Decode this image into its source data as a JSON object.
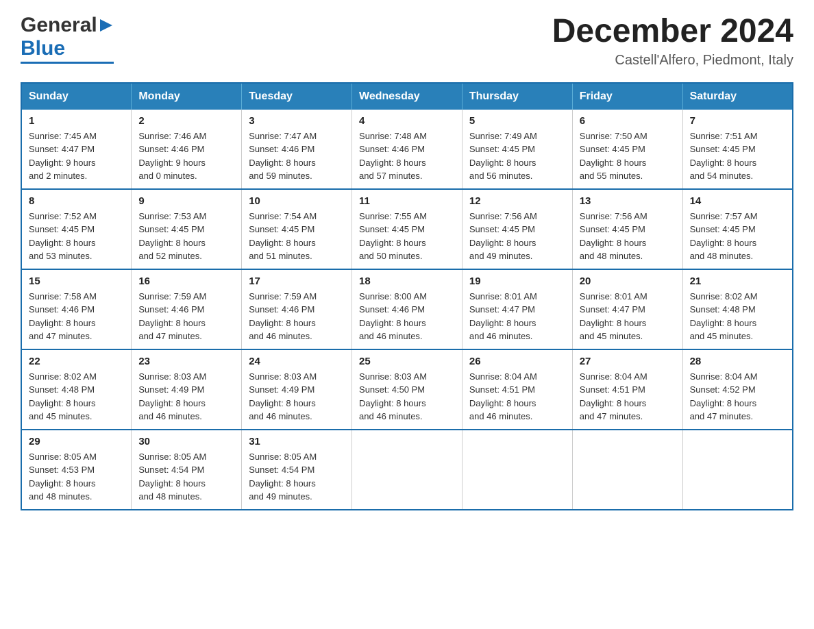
{
  "header": {
    "logo_general": "General",
    "logo_blue": "Blue",
    "month_title": "December 2024",
    "subtitle": "Castell'Alfero, Piedmont, Italy"
  },
  "days_of_week": [
    "Sunday",
    "Monday",
    "Tuesday",
    "Wednesday",
    "Thursday",
    "Friday",
    "Saturday"
  ],
  "weeks": [
    [
      {
        "num": "1",
        "sunrise": "7:45 AM",
        "sunset": "4:47 PM",
        "daylight": "9 hours and 2 minutes."
      },
      {
        "num": "2",
        "sunrise": "7:46 AM",
        "sunset": "4:46 PM",
        "daylight": "9 hours and 0 minutes."
      },
      {
        "num": "3",
        "sunrise": "7:47 AM",
        "sunset": "4:46 PM",
        "daylight": "8 hours and 59 minutes."
      },
      {
        "num": "4",
        "sunrise": "7:48 AM",
        "sunset": "4:46 PM",
        "daylight": "8 hours and 57 minutes."
      },
      {
        "num": "5",
        "sunrise": "7:49 AM",
        "sunset": "4:45 PM",
        "daylight": "8 hours and 56 minutes."
      },
      {
        "num": "6",
        "sunrise": "7:50 AM",
        "sunset": "4:45 PM",
        "daylight": "8 hours and 55 minutes."
      },
      {
        "num": "7",
        "sunrise": "7:51 AM",
        "sunset": "4:45 PM",
        "daylight": "8 hours and 54 minutes."
      }
    ],
    [
      {
        "num": "8",
        "sunrise": "7:52 AM",
        "sunset": "4:45 PM",
        "daylight": "8 hours and 53 minutes."
      },
      {
        "num": "9",
        "sunrise": "7:53 AM",
        "sunset": "4:45 PM",
        "daylight": "8 hours and 52 minutes."
      },
      {
        "num": "10",
        "sunrise": "7:54 AM",
        "sunset": "4:45 PM",
        "daylight": "8 hours and 51 minutes."
      },
      {
        "num": "11",
        "sunrise": "7:55 AM",
        "sunset": "4:45 PM",
        "daylight": "8 hours and 50 minutes."
      },
      {
        "num": "12",
        "sunrise": "7:56 AM",
        "sunset": "4:45 PM",
        "daylight": "8 hours and 49 minutes."
      },
      {
        "num": "13",
        "sunrise": "7:56 AM",
        "sunset": "4:45 PM",
        "daylight": "8 hours and 48 minutes."
      },
      {
        "num": "14",
        "sunrise": "7:57 AM",
        "sunset": "4:45 PM",
        "daylight": "8 hours and 48 minutes."
      }
    ],
    [
      {
        "num": "15",
        "sunrise": "7:58 AM",
        "sunset": "4:46 PM",
        "daylight": "8 hours and 47 minutes."
      },
      {
        "num": "16",
        "sunrise": "7:59 AM",
        "sunset": "4:46 PM",
        "daylight": "8 hours and 47 minutes."
      },
      {
        "num": "17",
        "sunrise": "7:59 AM",
        "sunset": "4:46 PM",
        "daylight": "8 hours and 46 minutes."
      },
      {
        "num": "18",
        "sunrise": "8:00 AM",
        "sunset": "4:46 PM",
        "daylight": "8 hours and 46 minutes."
      },
      {
        "num": "19",
        "sunrise": "8:01 AM",
        "sunset": "4:47 PM",
        "daylight": "8 hours and 46 minutes."
      },
      {
        "num": "20",
        "sunrise": "8:01 AM",
        "sunset": "4:47 PM",
        "daylight": "8 hours and 45 minutes."
      },
      {
        "num": "21",
        "sunrise": "8:02 AM",
        "sunset": "4:48 PM",
        "daylight": "8 hours and 45 minutes."
      }
    ],
    [
      {
        "num": "22",
        "sunrise": "8:02 AM",
        "sunset": "4:48 PM",
        "daylight": "8 hours and 45 minutes."
      },
      {
        "num": "23",
        "sunrise": "8:03 AM",
        "sunset": "4:49 PM",
        "daylight": "8 hours and 46 minutes."
      },
      {
        "num": "24",
        "sunrise": "8:03 AM",
        "sunset": "4:49 PM",
        "daylight": "8 hours and 46 minutes."
      },
      {
        "num": "25",
        "sunrise": "8:03 AM",
        "sunset": "4:50 PM",
        "daylight": "8 hours and 46 minutes."
      },
      {
        "num": "26",
        "sunrise": "8:04 AM",
        "sunset": "4:51 PM",
        "daylight": "8 hours and 46 minutes."
      },
      {
        "num": "27",
        "sunrise": "8:04 AM",
        "sunset": "4:51 PM",
        "daylight": "8 hours and 47 minutes."
      },
      {
        "num": "28",
        "sunrise": "8:04 AM",
        "sunset": "4:52 PM",
        "daylight": "8 hours and 47 minutes."
      }
    ],
    [
      {
        "num": "29",
        "sunrise": "8:05 AM",
        "sunset": "4:53 PM",
        "daylight": "8 hours and 48 minutes."
      },
      {
        "num": "30",
        "sunrise": "8:05 AM",
        "sunset": "4:54 PM",
        "daylight": "8 hours and 48 minutes."
      },
      {
        "num": "31",
        "sunrise": "8:05 AM",
        "sunset": "4:54 PM",
        "daylight": "8 hours and 49 minutes."
      },
      null,
      null,
      null,
      null
    ]
  ],
  "labels": {
    "sunrise": "Sunrise:",
    "sunset": "Sunset:",
    "daylight": "Daylight:"
  }
}
